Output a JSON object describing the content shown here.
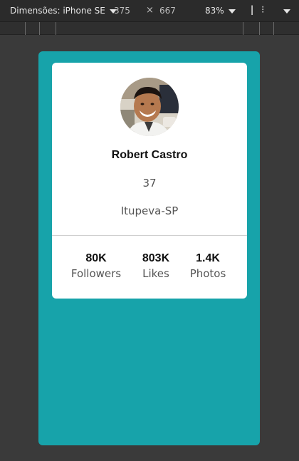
{
  "devtools": {
    "device_label": "Dimensões: iPhone SE",
    "width": "375",
    "times": "×",
    "height": "667",
    "zoom": "83%",
    "icon_more": "⁝"
  },
  "profile": {
    "name": "Robert Castro",
    "age": "37",
    "city": "Itupeva-SP",
    "avatar_icon": "profile-photo",
    "stats": [
      {
        "value": "80K",
        "label": "Followers"
      },
      {
        "value": "803K",
        "label": "Likes"
      },
      {
        "value": "1.4K",
        "label": "Photos"
      }
    ]
  },
  "colors": {
    "page_bg": "#3a3a3a",
    "device_bg": "#17a3aa",
    "card_bg": "#ffffff"
  }
}
